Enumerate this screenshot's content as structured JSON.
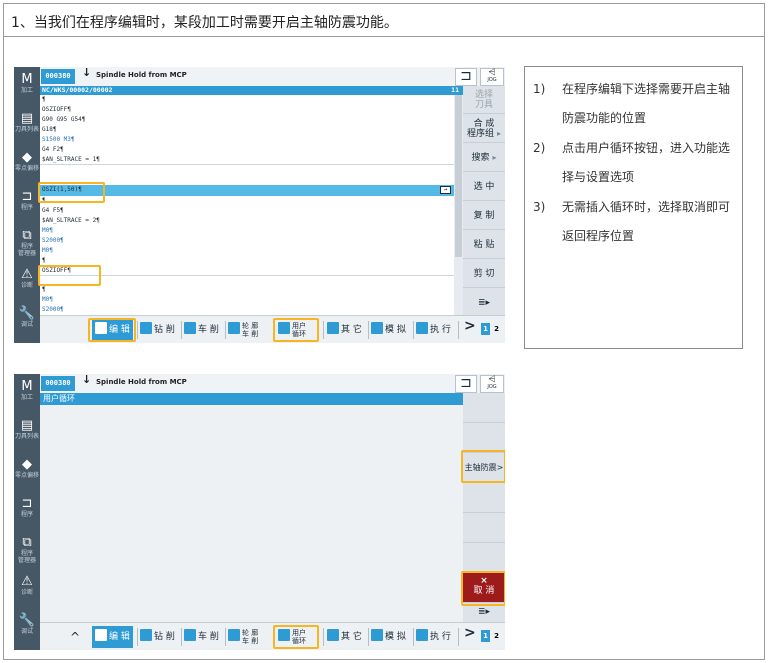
{
  "caption": "1、当我们在程序编辑时，某段加工时需要开启主轴防震功能。",
  "panel1": {
    "left_nav": [
      {
        "icon": "M",
        "label": "加工"
      },
      {
        "icon": "▤",
        "label": "刀具列表"
      },
      {
        "icon": "◆",
        "label": "零点偏移"
      },
      {
        "icon": "⊐",
        "label": "程序"
      },
      {
        "icon": "⧉",
        "label": "程序",
        "label2": "管理器"
      },
      {
        "icon": "⚠",
        "label": "诊断"
      },
      {
        "icon": "🔧",
        "label": "调试"
      }
    ],
    "header": {
      "prog_no": "000380",
      "message": "Spindle Hold from MCP"
    },
    "path": "NC/WKS/00002/00002",
    "path_right": "11",
    "code_lines": [
      "¶",
      "OSZIOFF¶",
      "G90 G95 G54¶",
      "G18¶",
      "S1500 M3¶",
      "G4 F2¶",
      "$AN_SLTRACE = 1¶",
      "OSZI(1,50)¶",
      "¶",
      "G4 F5¶",
      "$AN_SLTRACE = 2¶",
      "M0¶",
      "S2000¶",
      "M0¶",
      "¶",
      "OSZIOFF¶",
      "¶",
      "M0¶",
      "S2000¶"
    ],
    "right_softkeys": [
      {
        "label": "选择",
        "label2": "刀具"
      },
      {
        "label": "合 成",
        "label2": "程序组"
      },
      {
        "label": "搜索"
      },
      {
        "label": "选 中"
      },
      {
        "label": "复 制"
      },
      {
        "label": "粘 贴"
      },
      {
        "label": "剪 切"
      }
    ],
    "bottom_softkeys": {
      "edit": "编 辑",
      "drill": "钻 削",
      "turn": "车 削",
      "contour_a": "轮 廓",
      "contour_b": "车 削",
      "cycle_a": "用户",
      "cycle_b": "循环",
      "other": "其 它",
      "simulate": "模 拟",
      "execute": "执 行",
      "next": ">",
      "page1": "1",
      "page2": "2"
    }
  },
  "panel2": {
    "header": {
      "prog_no": "000380",
      "message": "Spindle Hold from MCP"
    },
    "form_title": "用户循环",
    "right_softkeys": {
      "spindle_damping": "主轴防震",
      "cancel_icon": "×",
      "cancel": "取 消"
    }
  },
  "notes": [
    {
      "num": "1)",
      "text": "在程序编辑下选择需要开启主轴防震功能的位置"
    },
    {
      "num": "2)",
      "text": "点击用户循环按钮，进入功能选择与设置选项"
    },
    {
      "num": "3)",
      "text": "无需插入循环时，选择取消即可返回程序位置"
    }
  ],
  "colors": {
    "accent_blue": "#2e9bd4",
    "highlight_yellow": "#f6b521",
    "nav_dark": "#465766",
    "cancel_red": "#9e1b1b"
  }
}
